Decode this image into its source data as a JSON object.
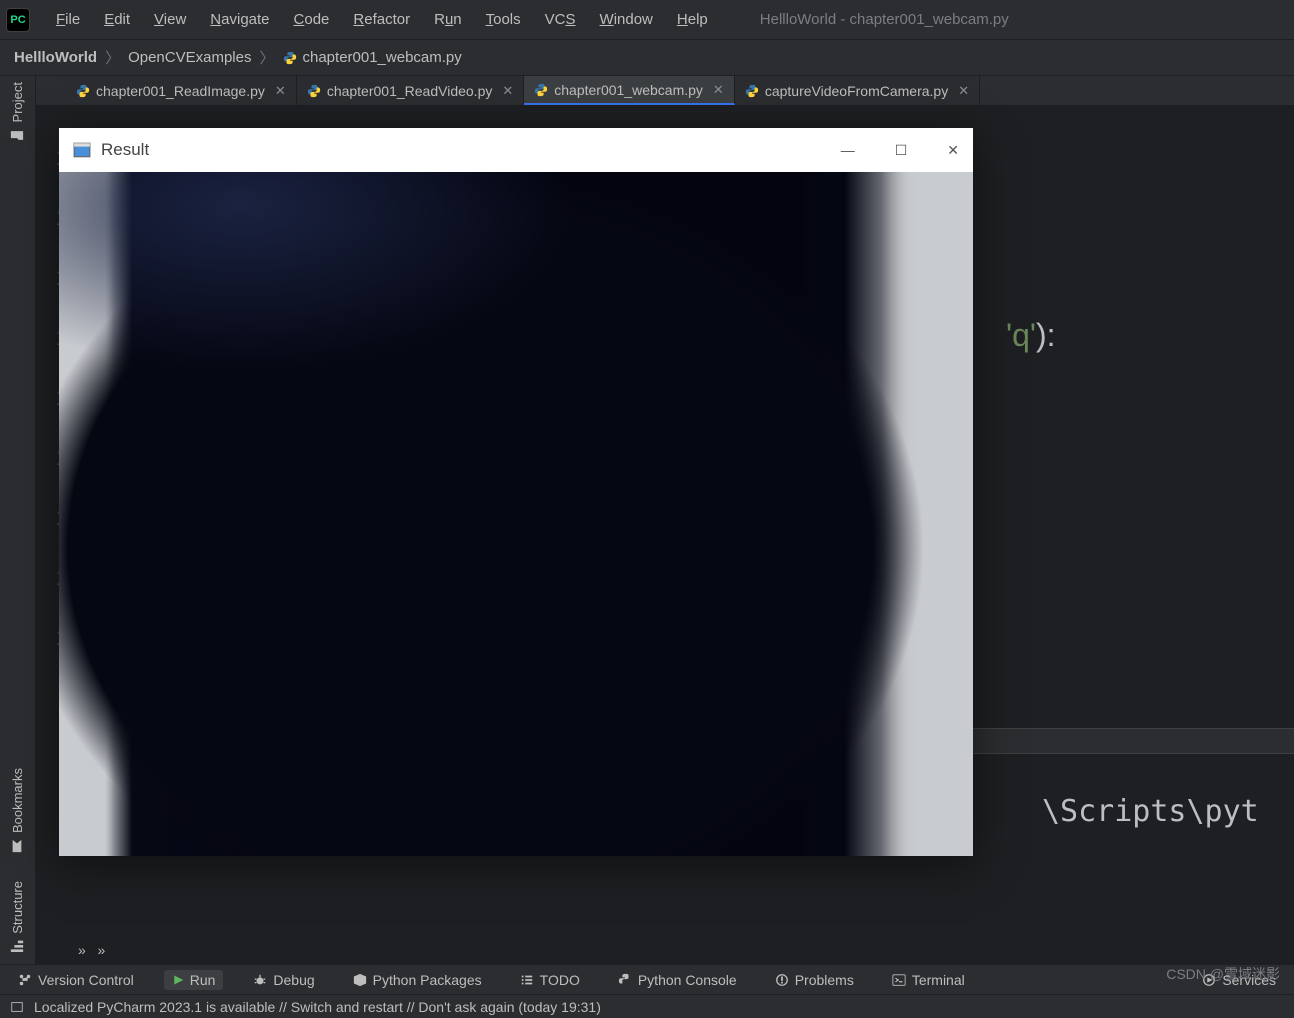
{
  "app": {
    "icon_label": "PC",
    "window_title": "HellloWorld - chapter001_webcam.py"
  },
  "menu": {
    "file": "File",
    "edit": "Edit",
    "view": "View",
    "navigate": "Navigate",
    "code": "Code",
    "refactor": "Refactor",
    "run": "Run",
    "tools": "Tools",
    "vcs": "VCS",
    "window": "Window",
    "help": "Help"
  },
  "breadcrumb": {
    "root": "HellloWorld",
    "folder": "OpenCVExamples",
    "file": "chapter001_webcam.py"
  },
  "tabs": [
    {
      "label": "chapter001_ReadImage.py",
      "active": false
    },
    {
      "label": "chapter001_ReadVideo.py",
      "active": false
    },
    {
      "label": "chapter001_webcam.py",
      "active": true
    },
    {
      "label": "captureVideoFromCamera.py",
      "active": false
    }
  ],
  "gutter_lines": [
    "1",
    "1",
    "1",
    "1",
    "1",
    "1",
    "1",
    "1",
    "1"
  ],
  "code_fragment": {
    "quote": "'",
    "ch": "q",
    "tail": "):"
  },
  "sidebar_rails": {
    "project": "Project",
    "bookmarks": "Bookmarks",
    "structure": "Structure"
  },
  "run_panel": {
    "label_prefix": "Ru"
  },
  "console_fragment": "\\Scripts\\pyt",
  "toolbar": {
    "version_control": "Version Control",
    "run": "Run",
    "debug": "Debug",
    "python_packages": "Python Packages",
    "todo": "TODO",
    "python_console": "Python Console",
    "problems": "Problems",
    "terminal": "Terminal",
    "services": "Services"
  },
  "statusbar": {
    "message": "Localized PyCharm 2023.1 is available // Switch and restart // Don't ask again (today 19:31)"
  },
  "result_window": {
    "title": "Result"
  },
  "watermark": "CSDN @雪域迷影"
}
